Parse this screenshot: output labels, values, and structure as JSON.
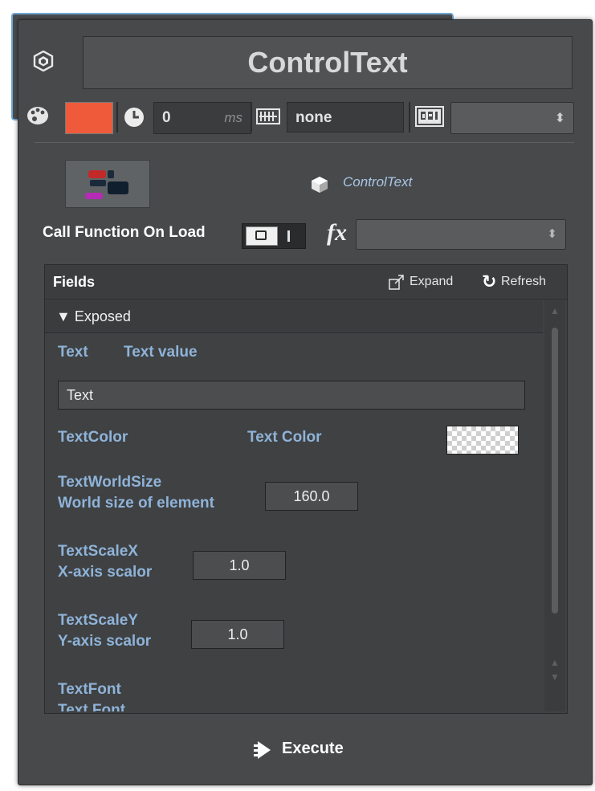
{
  "header": {
    "title": "ControlText",
    "icon": "script-hex-icon"
  },
  "toolbar": {
    "color": "#ee5a3a",
    "delay_value": "0",
    "delay_unit": "ms",
    "shortcut_value": "none",
    "gpi_value": ""
  },
  "script": {
    "name": "ControlText",
    "call_on_load_label": "Call Function On Load",
    "fx_label": "fx",
    "fx_value": ""
  },
  "fields": {
    "title": "Fields",
    "expand_label": "Expand",
    "refresh_label": "Refresh",
    "group_label": "▼ Exposed",
    "items": [
      {
        "name": "Text",
        "desc": "Text value",
        "value": "Text"
      },
      {
        "name": "TextColor",
        "desc": "Text Color",
        "value": ""
      },
      {
        "name": "TextWorldSize",
        "desc": "World size of element",
        "value": "160.0"
      },
      {
        "name": "TextScaleX",
        "desc": "X-axis scalor",
        "value": "1.0"
      },
      {
        "name": "TextScaleY",
        "desc": "Y-axis scalor",
        "value": "1.0"
      },
      {
        "name": "TextFont",
        "desc": "Text Font",
        "value": ""
      }
    ]
  },
  "footer": {
    "execute_label": "Execute"
  }
}
